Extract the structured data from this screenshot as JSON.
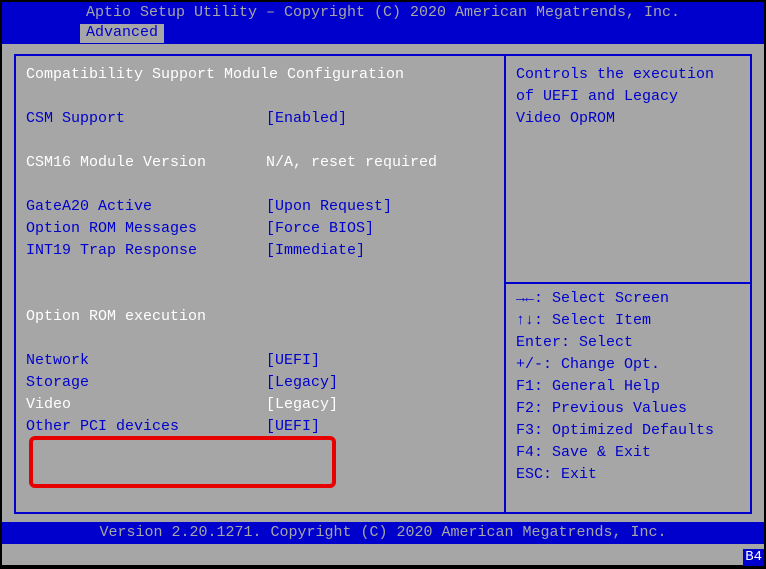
{
  "header": {
    "title": "Aptio Setup Utility – Copyright (C) 2020 American Megatrends, Inc.",
    "tab": "Advanced"
  },
  "left": {
    "section1": "Compatibility Support Module Configuration",
    "csm_support_label": "CSM Support",
    "csm_support_value": "[Enabled]",
    "csm16_label": "CSM16 Module Version",
    "csm16_value": "N/A, reset required",
    "gatea20_label": "GateA20 Active",
    "gatea20_value": "[Upon Request]",
    "oprom_msg_label": "Option ROM Messages",
    "oprom_msg_value": "[Force BIOS]",
    "int19_label": "INT19 Trap Response",
    "int19_value": "[Immediate]",
    "section2": "Option ROM execution",
    "network_label": "Network",
    "network_value": "[UEFI]",
    "storage_label": "Storage",
    "storage_value": "[Legacy]",
    "video_label": "Video",
    "video_value": "[Legacy]",
    "other_label": "Other PCI devices",
    "other_value": "[UEFI]"
  },
  "right": {
    "desc1": "Controls the execution",
    "desc2": "of UEFI and Legacy",
    "desc3": "Video OpROM",
    "k1": "→←: Select Screen",
    "k2": "↑↓: Select Item",
    "k3": "Enter: Select",
    "k4": "+/-: Change Opt.",
    "k5": "F1: General Help",
    "k6": "F2: Previous Values",
    "k7": "F3: Optimized Defaults",
    "k8": "F4: Save & Exit",
    "k9": "ESC: Exit"
  },
  "footer": {
    "text": "Version 2.20.1271. Copyright (C) 2020 American Megatrends, Inc."
  },
  "badge": "B4"
}
